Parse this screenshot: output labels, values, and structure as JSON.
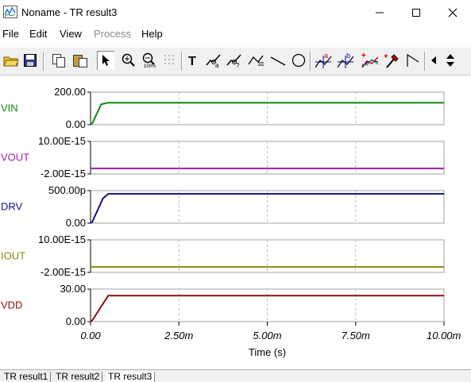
{
  "window": {
    "title": "Noname - TR result3"
  },
  "menu": [
    {
      "label": "File",
      "enabled": true
    },
    {
      "label": "Edit",
      "enabled": true
    },
    {
      "label": "View",
      "enabled": true
    },
    {
      "label": "Process",
      "enabled": false
    },
    {
      "label": "Help",
      "enabled": true
    }
  ],
  "toolbar": {
    "buttons": [
      "open-icon",
      "save-icon",
      "copy-icon",
      "paste-icon",
      "pointer-icon",
      "zoom-in-icon",
      "zoom-100-icon",
      "grid-icon",
      "text-icon",
      "cursor-a-icon",
      "cursor-b-icon",
      "curve-icon",
      "line-icon",
      "circle-icon",
      "marker-a-icon",
      "marker-b-icon",
      "add-curve-icon",
      "probe-icon",
      "waveform-icon",
      "scroll-left-icon",
      "scroll-updown-icon"
    ]
  },
  "colors": {
    "VIN": "#0a8a0a",
    "VOUT": "#a020a0",
    "DRV": "#10108a",
    "IOUT": "#8a8a10",
    "VDD": "#8a1010"
  },
  "chart_data": [
    {
      "type": "line",
      "series": [
        {
          "name": "VIN",
          "x": [
            0,
            0.05,
            0.3,
            0.5,
            10.0
          ],
          "y": [
            0,
            8,
            125,
            135,
            135
          ]
        }
      ],
      "ylim": [
        0,
        200
      ],
      "yticks": [
        "200.00",
        "0.00"
      ],
      "grid": true
    },
    {
      "type": "line",
      "series": [
        {
          "name": "VOUT",
          "x": [
            0,
            10.0
          ],
          "y": [
            0,
            0
          ]
        }
      ],
      "ylim": [
        -2e-15,
        1e-14
      ],
      "yticks": [
        "10.00E-15",
        "-2.00E-15"
      ],
      "grid": true
    },
    {
      "type": "line",
      "series": [
        {
          "name": "DRV",
          "x": [
            0,
            0.05,
            0.35,
            0.5,
            10.0
          ],
          "y": [
            0,
            20,
            380,
            450,
            450
          ]
        }
      ],
      "ylim": [
        0,
        500
      ],
      "yticks": [
        "500.00p",
        "0.00"
      ],
      "grid": true
    },
    {
      "type": "line",
      "series": [
        {
          "name": "IOUT",
          "x": [
            0,
            10.0
          ],
          "y": [
            0,
            0
          ]
        }
      ],
      "ylim": [
        -2e-15,
        1e-14
      ],
      "yticks": [
        "10.00E-15",
        "-2.00E-15"
      ],
      "grid": true
    },
    {
      "type": "line",
      "series": [
        {
          "name": "VDD",
          "x": [
            0,
            0.05,
            0.5,
            10.0
          ],
          "y": [
            0,
            1.2,
            24,
            24
          ]
        }
      ],
      "ylim": [
        0,
        30
      ],
      "yticks": [
        "30.00",
        "0.00"
      ],
      "grid": true
    }
  ],
  "x_axis": {
    "label": "Time (s)",
    "range": [
      0,
      10
    ],
    "ticks": [
      {
        "value": 0,
        "label": "0.00"
      },
      {
        "value": 2.5,
        "label": "2.50m"
      },
      {
        "value": 5.0,
        "label": "5.00m"
      },
      {
        "value": 7.5,
        "label": "7.50m"
      },
      {
        "value": 10.0,
        "label": "10.00m"
      }
    ]
  },
  "tabs": [
    {
      "label": "TR result1",
      "active": false
    },
    {
      "label": "TR result2",
      "active": false
    },
    {
      "label": "TR result3",
      "active": true
    }
  ]
}
